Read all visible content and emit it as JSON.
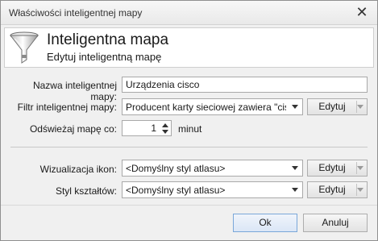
{
  "window": {
    "title": "Właściwości inteligentnej mapy",
    "close_glyph": "✕"
  },
  "header": {
    "title": "Inteligentna mapa",
    "subtitle": "Edytuj inteligentną mapę",
    "icon": "funnel-icon"
  },
  "form": {
    "name_label": "Nazwa inteligentnej mapy:",
    "name_value": "Urządzenia cisco",
    "filter_label": "Filtr inteligentnej mapy:",
    "filter_value": "Producent karty sieciowej zawiera \"cisco\"",
    "filter_edit_label": "Edytuj",
    "refresh_label": "Odświeżaj mapę co:",
    "refresh_value": "1",
    "refresh_unit": "minut",
    "icons_label": "Wizualizacja ikon:",
    "icons_value": "<Domyślny styl atlasu>",
    "icons_edit_label": "Edytuj",
    "shapes_label": "Styl kształtów:",
    "shapes_value": "<Domyślny styl atlasu>",
    "shapes_edit_label": "Edytuj"
  },
  "footer": {
    "ok_label": "Ok",
    "cancel_label": "Anuluj"
  }
}
